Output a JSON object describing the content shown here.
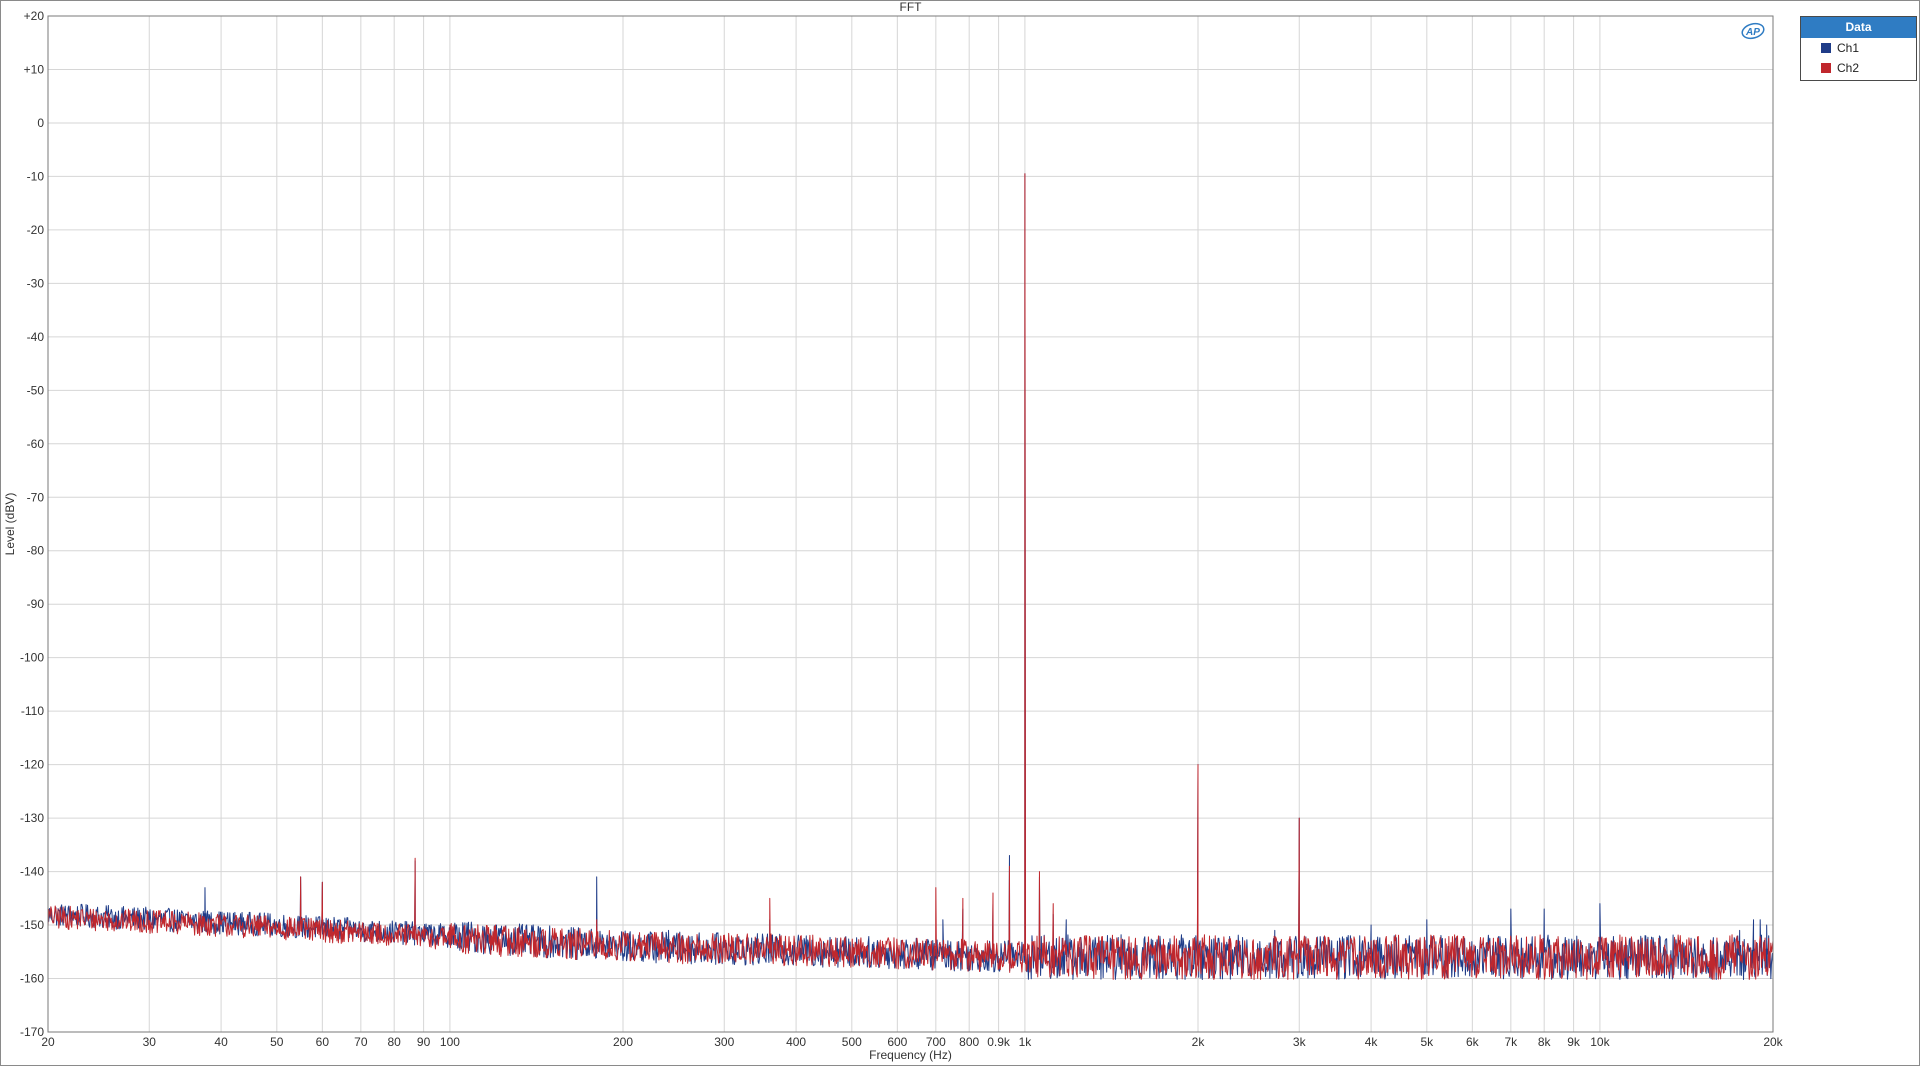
{
  "chart_data": {
    "type": "line",
    "title": "FFT",
    "xlabel": "Frequency (Hz)",
    "ylabel": "Level (dBV)",
    "x_scale": "log",
    "xlim": [
      20,
      20000
    ],
    "ylim": [
      -170,
      20
    ],
    "grid": true,
    "legend_position": "top-right",
    "legend_title": "Data",
    "x_ticks": [
      20,
      30,
      40,
      50,
      60,
      70,
      80,
      90,
      100,
      200,
      300,
      400,
      500,
      600,
      700,
      800,
      900,
      1000,
      2000,
      3000,
      4000,
      5000,
      6000,
      7000,
      8000,
      9000,
      10000,
      20000
    ],
    "x_tick_labels": [
      "20",
      "30",
      "40",
      "50",
      "60",
      "70",
      "80",
      "90",
      "100",
      "200",
      "300",
      "400",
      "500",
      "600",
      "700",
      "800",
      "0.9k",
      "1k",
      "2k",
      "3k",
      "4k",
      "5k",
      "6k",
      "7k",
      "8k",
      "9k",
      "10k",
      "20k"
    ],
    "y_ticks": [
      20,
      10,
      0,
      -10,
      -20,
      -30,
      -40,
      -50,
      -60,
      -70,
      -80,
      -90,
      -100,
      -110,
      -120,
      -130,
      -140,
      -150,
      -160,
      -170
    ],
    "y_tick_labels": [
      "+20",
      "+10",
      "0",
      "-10",
      "-20",
      "-30",
      "-40",
      "-50",
      "-60",
      "-70",
      "-80",
      "-90",
      "-100",
      "-110",
      "-120",
      "-130",
      "-140",
      "-150",
      "-160",
      "-170"
    ],
    "series": [
      {
        "name": "Ch1",
        "color": "#1f3c88",
        "noise_floor": [
          [
            20,
            -148
          ],
          [
            50,
            -150
          ],
          [
            100,
            -152
          ],
          [
            200,
            -154
          ],
          [
            500,
            -155
          ],
          [
            1000,
            -156
          ],
          [
            2000,
            -156
          ],
          [
            5000,
            -156
          ],
          [
            10000,
            -156
          ],
          [
            20000,
            -156
          ]
        ],
        "peaks": [
          [
            37.5,
            -143
          ],
          [
            55,
            -141
          ],
          [
            60,
            -142
          ],
          [
            87,
            -138
          ],
          [
            100,
            -150
          ],
          [
            120,
            -151
          ],
          [
            180,
            -141
          ],
          [
            240,
            -151
          ],
          [
            300,
            -152
          ],
          [
            360,
            -149
          ],
          [
            720,
            -149
          ],
          [
            780,
            -147
          ],
          [
            880,
            -146
          ],
          [
            940,
            -137
          ],
          [
            1000,
            -9.5
          ],
          [
            1060,
            -141
          ],
          [
            1120,
            -148
          ],
          [
            1180,
            -149
          ],
          [
            2000,
            -120
          ],
          [
            2720,
            -151
          ],
          [
            3000,
            -130
          ],
          [
            4000,
            -150
          ],
          [
            5000,
            -149
          ],
          [
            7000,
            -147
          ],
          [
            8000,
            -147
          ],
          [
            10000,
            -146
          ],
          [
            17500,
            -151
          ],
          [
            18500,
            -149
          ],
          [
            19000,
            -149
          ],
          [
            19500,
            -150
          ]
        ]
      },
      {
        "name": "Ch2",
        "color": "#c0272d",
        "noise_floor": [
          [
            20,
            -148.5
          ],
          [
            50,
            -150.5
          ],
          [
            100,
            -152.5
          ],
          [
            200,
            -154
          ],
          [
            500,
            -155
          ],
          [
            1000,
            -156
          ],
          [
            2000,
            -156
          ],
          [
            5000,
            -156
          ],
          [
            10000,
            -156
          ],
          [
            20000,
            -156
          ]
        ],
        "peaks": [
          [
            55,
            -141
          ],
          [
            60,
            -142
          ],
          [
            87,
            -137.5
          ],
          [
            100,
            -150
          ],
          [
            120,
            -150
          ],
          [
            180,
            -149
          ],
          [
            300,
            -152
          ],
          [
            360,
            -145
          ],
          [
            700,
            -143
          ],
          [
            780,
            -145
          ],
          [
            880,
            -144
          ],
          [
            940,
            -139
          ],
          [
            1000,
            -9.5
          ],
          [
            1060,
            -140
          ],
          [
            1120,
            -146
          ],
          [
            2000,
            -120
          ],
          [
            3000,
            -130
          ]
        ]
      }
    ]
  }
}
